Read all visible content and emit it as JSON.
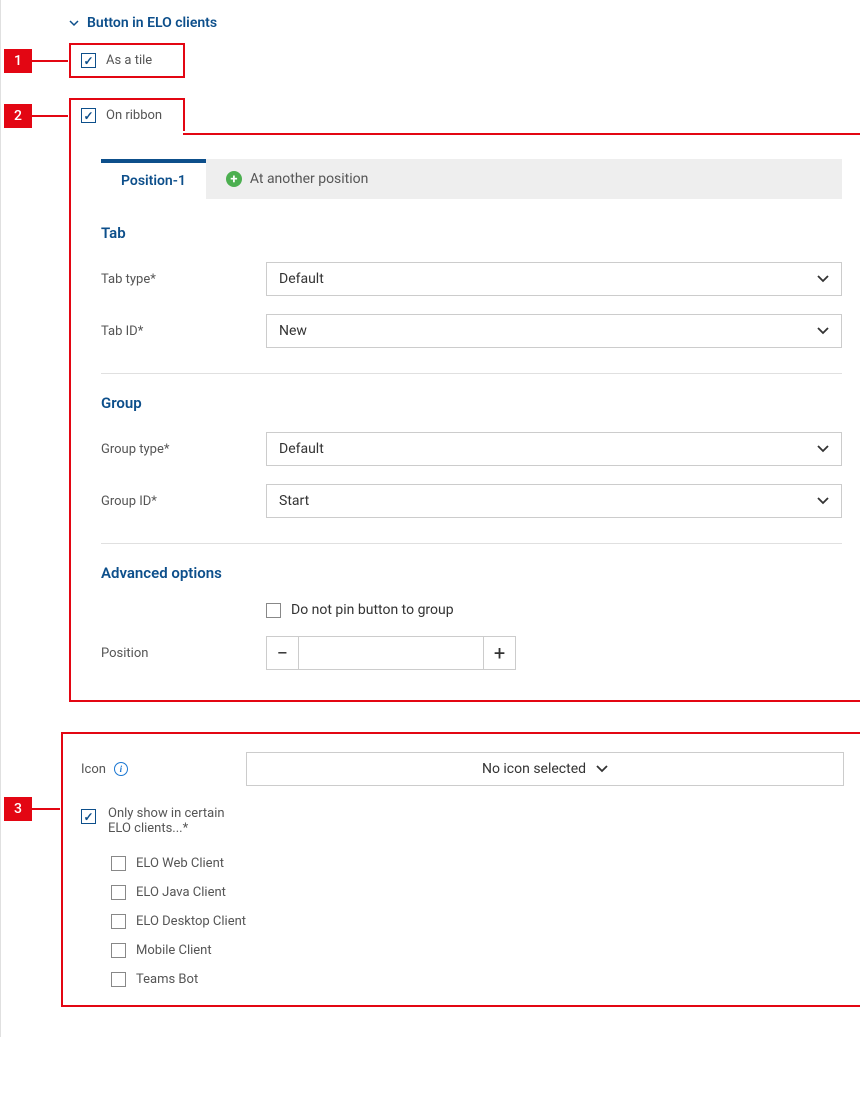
{
  "callouts": {
    "n1": "1",
    "n2": "2",
    "n3": "3"
  },
  "header": {
    "title": "Button in ELO clients"
  },
  "section1": {
    "label": "As a tile"
  },
  "section2": {
    "label": "On ribbon",
    "tabs": {
      "active": "Position-1",
      "add": "At another position"
    },
    "tabSection": {
      "title": "Tab",
      "tabType": {
        "label": "Tab type*",
        "value": "Default"
      },
      "tabId": {
        "label": "Tab ID*",
        "value": "New"
      }
    },
    "groupSection": {
      "title": "Group",
      "groupType": {
        "label": "Group type*",
        "value": "Default"
      },
      "groupId": {
        "label": "Group ID*",
        "value": "Start"
      }
    },
    "advancedSection": {
      "title": "Advanced options",
      "noPinLabel": "Do not pin button to group",
      "positionLabel": "Position"
    }
  },
  "section3": {
    "iconLabel": "Icon",
    "iconSelected": "No icon selected",
    "onlyShowLabel": "Only show in certain ELO clients...*",
    "clients": [
      "ELO Web Client",
      "ELO Java Client",
      "ELO Desktop Client",
      "Mobile Client",
      "Teams Bot"
    ]
  }
}
